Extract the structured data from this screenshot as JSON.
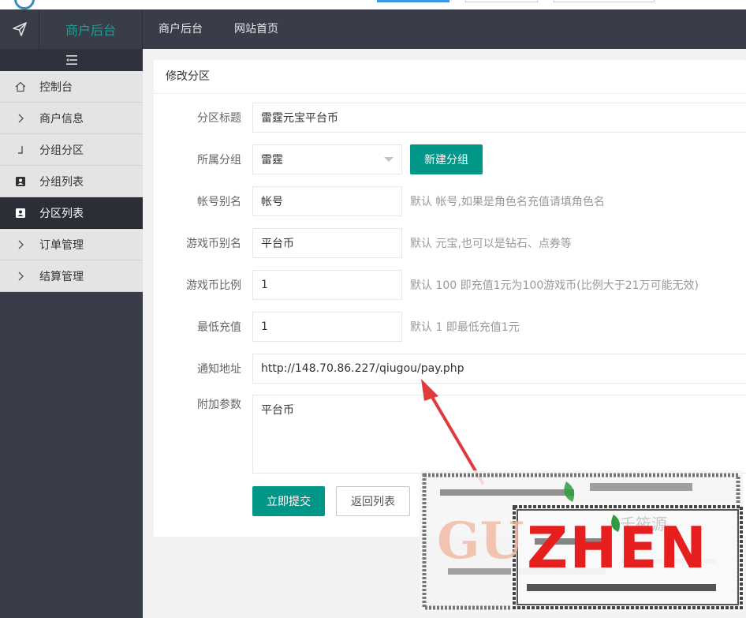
{
  "header": {
    "brand": "商户后台",
    "nav": [
      "商户后台",
      "网站首页"
    ]
  },
  "sidebar": {
    "items": [
      {
        "label": "控制台",
        "icon": "home-icon"
      },
      {
        "label": "商户信息",
        "icon": "chevron-right-icon"
      },
      {
        "label": "分组分区",
        "icon": "corner-icon"
      },
      {
        "label": "分组列表",
        "icon": "contact-icon"
      },
      {
        "label": "分区列表",
        "icon": "contact-icon"
      },
      {
        "label": "订单管理",
        "icon": "chevron-right-icon"
      },
      {
        "label": "结算管理",
        "icon": "chevron-right-icon"
      }
    ]
  },
  "card": {
    "title": "修改分区"
  },
  "form": {
    "title_label": "分区标题",
    "title_value": "雷霆元宝平台币",
    "group_label": "所属分组",
    "group_value": "雷霆",
    "new_group_button": "新建分组",
    "account_alias_label": "帐号别名",
    "account_alias_value": "帐号",
    "account_alias_hint": "默认 帐号,如果是角色名充值请填角色名",
    "coin_alias_label": "游戏币别名",
    "coin_alias_value": "平台币",
    "coin_alias_hint": "默认 元宝,也可以是钻石、点券等",
    "coin_ratio_label": "游戏币比例",
    "coin_ratio_value": "1",
    "coin_ratio_hint": "默认 100 即充值1元为100游戏币(比例大于21万可能无效)",
    "min_recharge_label": "最低充值",
    "min_recharge_value": "1",
    "min_recharge_hint": "默认 1 即最低充值1元",
    "notify_url_label": "通知地址",
    "notify_url_value": "http://148.70.86.227/qiugou/pay.php",
    "extra_params_label": "附加参数",
    "extra_params_value": "平台币",
    "submit_button": "立即提交",
    "back_button": "返回列表"
  },
  "watermark": {
    "text_main": "ZHEN",
    "text_faded": "GU",
    "text_small": "千筱源"
  },
  "colors": {
    "primary": "#009688",
    "header_bg": "#393d49",
    "brand": "#1aa094",
    "arrow": "#e0393e",
    "watermark_red": "#e61e1e"
  }
}
